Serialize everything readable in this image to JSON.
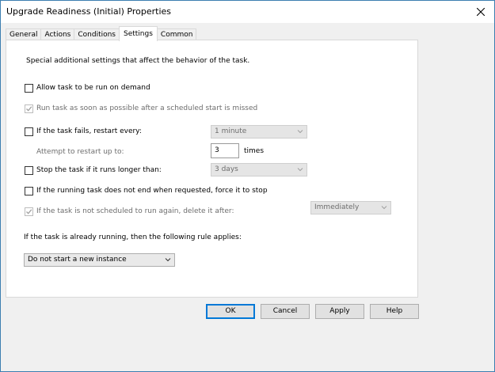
{
  "window": {
    "title": "Upgrade Readiness (Initial) Properties"
  },
  "tabs": [
    {
      "label": "General",
      "active": false
    },
    {
      "label": "Actions",
      "active": false
    },
    {
      "label": "Conditions",
      "active": false
    },
    {
      "label": "Settings",
      "active": true
    },
    {
      "label": "Common",
      "active": false
    }
  ],
  "settings": {
    "description": "Special additional settings that affect the behavior of the task.",
    "allow_on_demand": {
      "label": "Allow task to be run on demand",
      "checked": false,
      "enabled": true
    },
    "run_missed": {
      "label": "Run task as soon as possible after a scheduled start is missed",
      "checked": true,
      "enabled": false
    },
    "restart_on_fail": {
      "label": "If the task fails, restart every:",
      "checked": false,
      "enabled": true,
      "interval_value": "1 minute",
      "attempt_label": "Attempt to restart up to:",
      "attempt_value": "3",
      "times_label": "times"
    },
    "stop_if_longer": {
      "label": "Stop the task if it runs longer than:",
      "checked": false,
      "enabled": true,
      "duration_value": "3 days"
    },
    "force_stop": {
      "label": "If the running task does not end when requested, force it to stop",
      "checked": false,
      "enabled": true
    },
    "delete_after": {
      "label": "If the task is not scheduled to run again, delete it after:",
      "checked": true,
      "enabled": false,
      "delay_value": "Immediately"
    },
    "running_rule_label": "If the task is already running, then the following rule applies:",
    "running_rule_value": "Do not start a new instance"
  },
  "buttons": {
    "ok": "OK",
    "cancel": "Cancel",
    "apply": "Apply",
    "help": "Help"
  },
  "colors": {
    "window_border": "#3c7fb1",
    "default_button_border": "#0078d7",
    "dialog_bg": "#f0f0f0"
  }
}
